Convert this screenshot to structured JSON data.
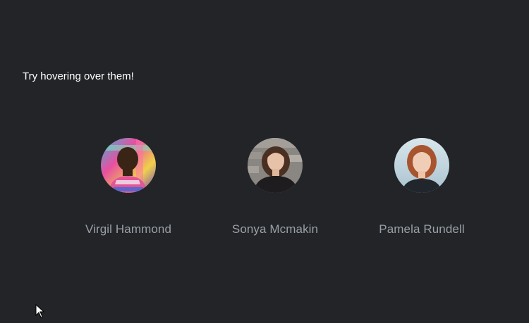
{
  "hint": "Try hovering over them!",
  "people": [
    {
      "name": "Virgil Hammond",
      "avatar": "avatar-photo"
    },
    {
      "name": "Sonya Mcmakin",
      "avatar": "avatar-photo"
    },
    {
      "name": "Pamela Rundell",
      "avatar": "avatar-photo"
    }
  ],
  "colors": {
    "background": "#222428",
    "hint_text": "#ffffff",
    "name_text": "#9aa0a6"
  }
}
